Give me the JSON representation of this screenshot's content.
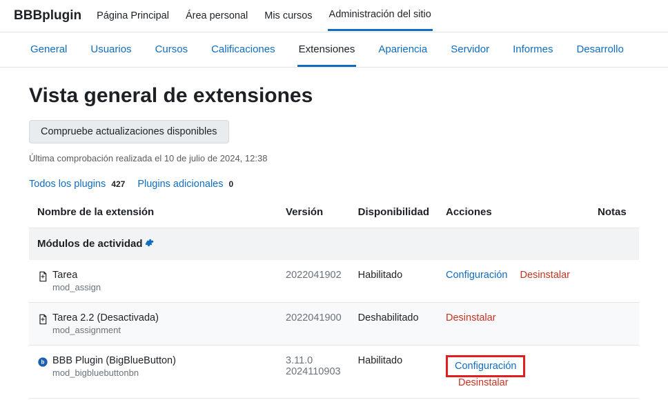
{
  "brand": "BBBplugin",
  "topnav": {
    "items": [
      "Página Principal",
      "Área personal",
      "Mis cursos",
      "Administración del sitio"
    ],
    "active_index": 3
  },
  "subnav": {
    "items": [
      "General",
      "Usuarios",
      "Cursos",
      "Calificaciones",
      "Extensiones",
      "Apariencia",
      "Servidor",
      "Informes",
      "Desarrollo"
    ],
    "active_index": 4
  },
  "page_title": "Vista general de extensiones",
  "check_button": "Compruebe actualizaciones disponibles",
  "last_check": "Última comprobación realizada el 10 de julio de 2024, 12:38",
  "filters": {
    "all_label": "Todos los plugins",
    "all_count": "427",
    "additional_label": "Plugins adicionales",
    "additional_count": "0"
  },
  "table": {
    "headers": {
      "name": "Nombre de la extensión",
      "version": "Versión",
      "availability": "Disponibilidad",
      "actions": "Acciones",
      "notes": "Notas"
    },
    "category": "Módulos de actividad",
    "rows": [
      {
        "title": "Tarea",
        "code": "mod_assign",
        "version": "2022041902",
        "version2": "",
        "availability": "Habilitado",
        "configure": "Configuración",
        "uninstall": "Desinstalar",
        "disabled": false,
        "highlight": false,
        "icon": "doc"
      },
      {
        "title": "Tarea 2.2 (Desactivada)",
        "code": "mod_assignment",
        "version": "2022041900",
        "version2": "",
        "availability": "Deshabilitado",
        "configure": "",
        "uninstall": "Desinstalar",
        "disabled": true,
        "highlight": false,
        "icon": "doc"
      },
      {
        "title": "BBB Plugin (BigBlueButton)",
        "code": "mod_bigbluebuttonbn",
        "version": "3.11.0",
        "version2": "2024110903",
        "availability": "Habilitado",
        "configure": "Configuración",
        "uninstall": "Desinstalar",
        "disabled": false,
        "highlight": true,
        "icon": "bbb"
      }
    ]
  }
}
